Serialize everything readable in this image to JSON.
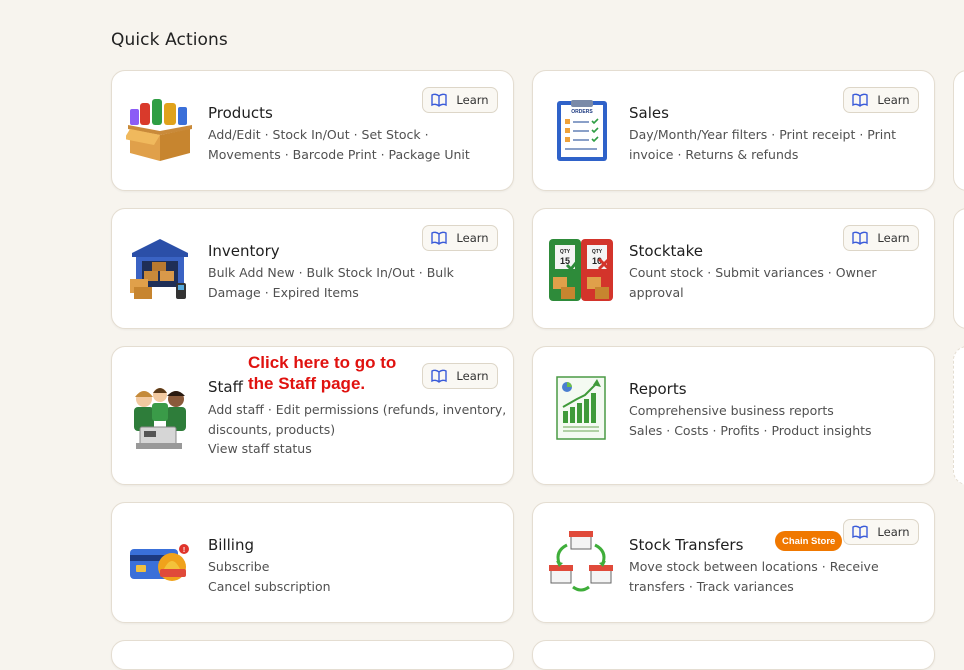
{
  "section_title": "Quick Actions",
  "annotation": {
    "line1": "Click here to go to",
    "line2": "the Staff page."
  },
  "learn_label": "Learn",
  "cards": {
    "products": {
      "title": "Products",
      "desc1": "Add/Edit · Stock In/Out · Set Stock ·",
      "desc2": "Movements · Barcode Print · Package Unit"
    },
    "sales": {
      "title": "Sales",
      "desc1": "Day/Month/Year filters · Print receipt · Print",
      "desc2": "invoice · Returns & refunds"
    },
    "inventory": {
      "title": "Inventory",
      "desc1": "Bulk Add New · Bulk Stock In/Out · Bulk",
      "desc2": "Damage · Expired Items"
    },
    "stocktake": {
      "title": "Stocktake",
      "desc1": "Count stock · Submit variances · Owner",
      "desc2": "approval"
    },
    "staff": {
      "title": "Staff",
      "desc1": "Add staff · Edit permissions (refunds, inventory,",
      "desc2": "discounts, products)",
      "desc3": "View staff status"
    },
    "reports": {
      "title": "Reports",
      "desc1": "Comprehensive business reports",
      "desc2": "Sales · Costs · Profits · Product insights"
    },
    "billing": {
      "title": "Billing",
      "desc1": "Subscribe",
      "desc2": "Cancel subscription"
    },
    "stock_transfers": {
      "title": "Stock Transfers",
      "badge": "Chain Store",
      "desc1": "Move stock between locations · Receive",
      "desc2": "transfers · Track variances"
    }
  },
  "icon_text": {
    "orders": "ORDERS",
    "qty": "QTY",
    "qty_left": "15",
    "qty_right": "10"
  },
  "colors": {
    "badge": "#f07800",
    "annotation": "#e0120f",
    "learn_icon": "#3a5bd9"
  }
}
